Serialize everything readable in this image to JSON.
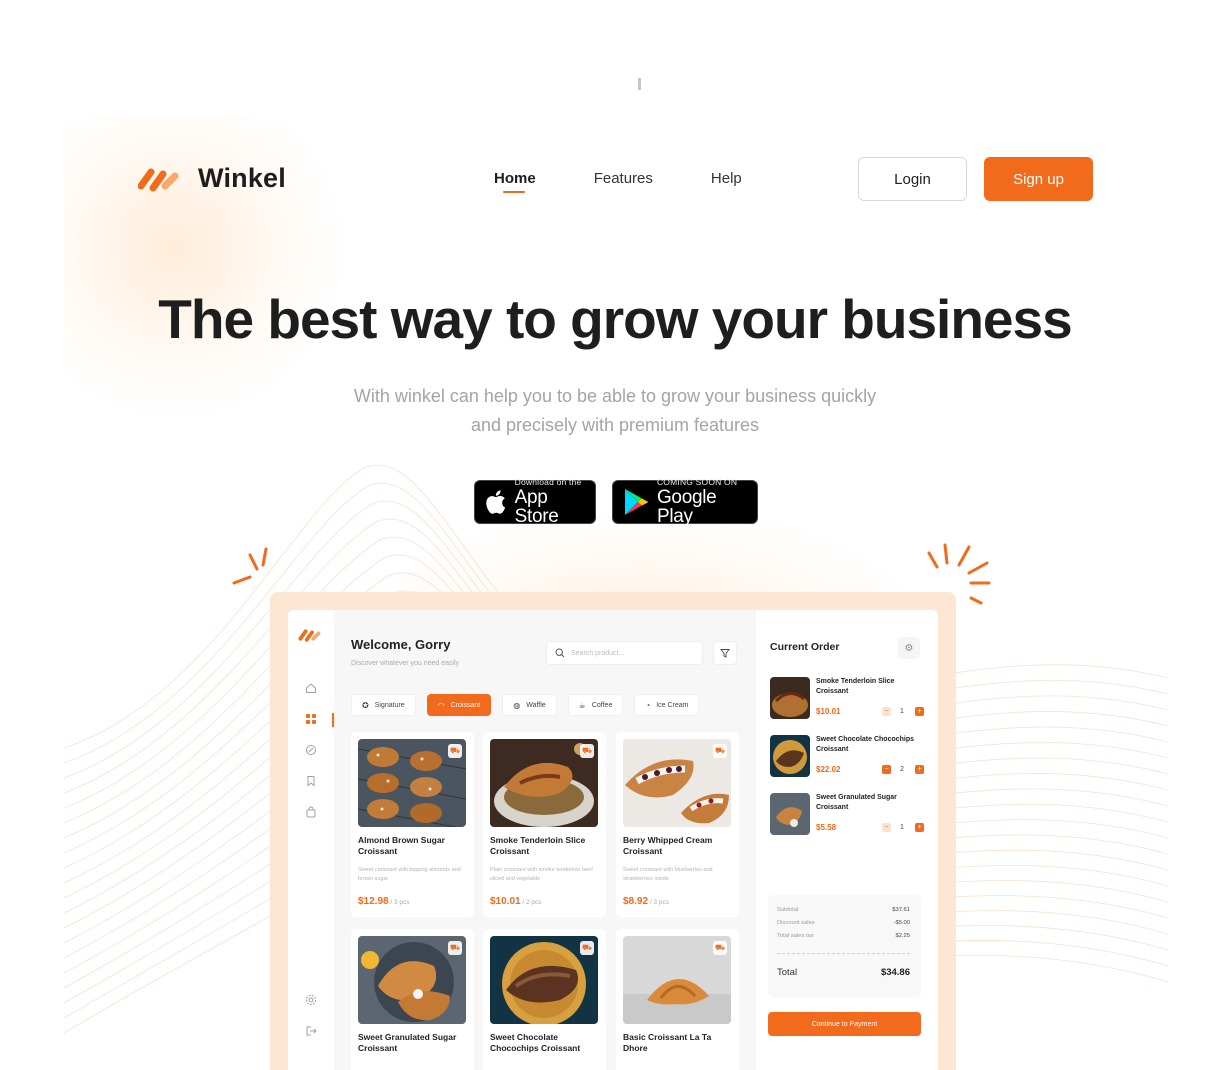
{
  "brand": {
    "name": "Winkel",
    "accent": "#f26a1b"
  },
  "nav": {
    "links": [
      "Home",
      "Features",
      "Help"
    ],
    "active": "Home"
  },
  "auth": {
    "login_label": "Login",
    "signup_label": "Sign up"
  },
  "hero": {
    "title": "The best way to grow your business",
    "subtitle_line1": "With winkel can help you to be able to grow your business quickly",
    "subtitle_line2": "and precisely with premium features"
  },
  "stores": {
    "app_store": {
      "small": "Download on the",
      "big": "App Store",
      "icon": "apple-icon"
    },
    "google_play": {
      "small": "COMING SOON ON",
      "big": "Google Play",
      "icon": "google-play-icon"
    }
  },
  "dashboard": {
    "welcome": "Welcome, Gorry",
    "welcome_sub": "Discover whatever you need easily",
    "search_placeholder": "Search product...",
    "sidebar_icons": [
      "home-icon",
      "grid-icon",
      "discount-icon",
      "bookmark-icon",
      "bag-icon",
      "settings-icon",
      "logout-icon"
    ],
    "categories": [
      {
        "label": "Signature",
        "icon": "star-icon",
        "active": false
      },
      {
        "label": "Croissant",
        "icon": "croissant-icon",
        "active": true
      },
      {
        "label": "Waffle",
        "icon": "waffle-icon",
        "active": false
      },
      {
        "label": "Coffee",
        "icon": "coffee-icon",
        "active": false
      },
      {
        "label": "Ice Cream",
        "icon": "ice-cream-icon",
        "active": false
      }
    ],
    "products": [
      {
        "title": "Almond Brown Sugar Croissant",
        "desc": "Sweet croissant with topping almonds and brown sugar",
        "price": "$12.98",
        "unit": " / 3 pcs"
      },
      {
        "title": "Smoke Tenderloin Slice Croissant",
        "desc": "Plain croissant with smoke tenderloin beef sliced and vegetable",
        "price": "$10.01",
        "unit": " / 2 pcs"
      },
      {
        "title": "Berry Whipped Cream Croissant",
        "desc": "Sweet croissant with blueberries and strawberries inside",
        "price": "$8.92",
        "unit": " / 3 pcs"
      },
      {
        "title": "Sweet Granulated Sugar Croissant",
        "desc": "",
        "price": "",
        "unit": ""
      },
      {
        "title": "Sweet Chocolate Chocochips Croissant",
        "desc": "",
        "price": "",
        "unit": ""
      },
      {
        "title": "Basic Croissant La Ta Dhore",
        "desc": "",
        "price": "",
        "unit": ""
      }
    ],
    "order": {
      "title": "Current Order",
      "items": [
        {
          "name": "Smoke Tenderloin Slice Croissant",
          "price": "$10.01",
          "qty": "1"
        },
        {
          "name": "Sweet Chocolate Chocochips Croissant",
          "price": "$22.02",
          "qty": "2"
        },
        {
          "name": "Sweet Granulated Sugar Croissant",
          "price": "$5.58",
          "qty": "1"
        }
      ],
      "summary": [
        {
          "label": "Subtotal",
          "value": "$37.61"
        },
        {
          "label": "Discount sales",
          "value": "-$5.00"
        },
        {
          "label": "Total sales tax",
          "value": "$2.25"
        }
      ],
      "total_label": "Total",
      "total_value": "$34.86",
      "cta": "Continue to Payment"
    }
  }
}
